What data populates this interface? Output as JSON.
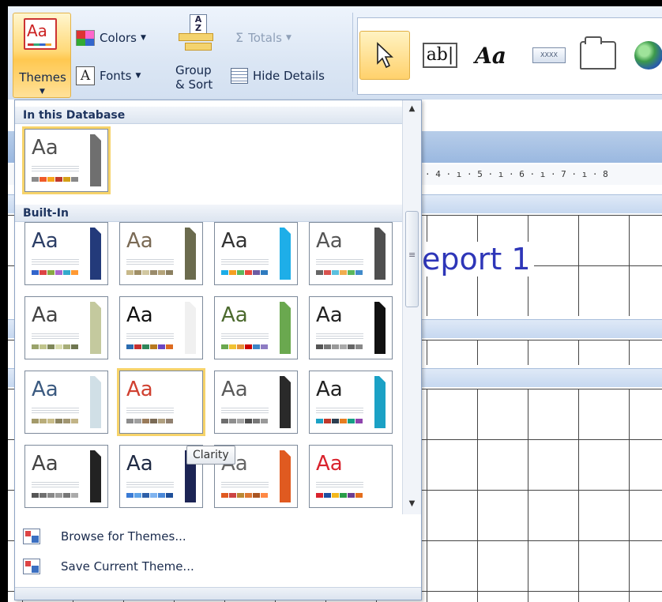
{
  "ribbon": {
    "themes_label": "Themes",
    "colors_label": "Colors",
    "fonts_label": "Fonts",
    "group_sort_label_1": "Group",
    "group_sort_label_2": "& Sort",
    "totals_label": "Totals",
    "hide_details_label": "Hide Details",
    "sort_icon_text": "A Z",
    "controls": {
      "textbox_text": "ab|",
      "label_text": "Aa",
      "button_text": "XXXX"
    }
  },
  "report": {
    "title": "eport 1",
    "ruler": "· 4 · ı · 5 · ı · 6 · ı · 7 · ı · 8"
  },
  "gallery": {
    "section_db": "In this Database",
    "section_builtin": "Built-In",
    "tooltip": "Clarity",
    "browse_label": "Browse for Themes...",
    "save_label": "Save Current Theme...",
    "themes": [
      {
        "aa": "Aa",
        "color": "#505050",
        "strip": "#6f6f6f",
        "swatches": [
          "#8a8a8a",
          "#f05a28",
          "#f7a51c",
          "#c0392b",
          "#d4a017",
          "#888"
        ]
      },
      {
        "aa": "Aa",
        "color": "#2c3e66",
        "strip": "#233a7a",
        "swatches": [
          "#36c",
          "#d44",
          "#8a4",
          "#a6c",
          "#3ac",
          "#f93"
        ]
      },
      {
        "aa": "Aa",
        "color": "#7a6a55",
        "strip": "#6b6b4e",
        "swatches": [
          "#c8b98a",
          "#a08f66",
          "#d1c7a0",
          "#9a8b6b",
          "#b5a47a",
          "#8b7f60"
        ]
      },
      {
        "aa": "Aa",
        "color": "#333333",
        "strip": "#1eaee8",
        "swatches": [
          "#1eaee8",
          "#f59f20",
          "#5cb85c",
          "#e94b3c",
          "#6d5ba3",
          "#2f7bbf"
        ]
      },
      {
        "aa": "Aa",
        "color": "#555555",
        "strip": "#4f4f4f",
        "swatches": [
          "#666",
          "#d9534f",
          "#5bc0de",
          "#f0ad4e",
          "#5cb85c",
          "#428bca"
        ]
      },
      {
        "aa": "Aa",
        "color": "#444444",
        "strip": "#c4c99e",
        "swatches": [
          "#9aa36b",
          "#c0c48c",
          "#7f8759",
          "#d9dcae",
          "#a7ad78",
          "#6f7650"
        ]
      },
      {
        "aa": "Aa",
        "color": "#111111",
        "strip": "#f0f0f0",
        "swatches": [
          "#2b6cb0",
          "#c53030",
          "#2f855a",
          "#b7791f",
          "#6b46c1",
          "#dd6b20"
        ]
      },
      {
        "aa": "Aa",
        "color": "#4c6a2e",
        "strip": "#6aa84f",
        "swatches": [
          "#6aa84f",
          "#f1c232",
          "#e69138",
          "#cc0000",
          "#3d85c6",
          "#8e7cc3"
        ]
      },
      {
        "aa": "Aa",
        "color": "#222222",
        "strip": "#111111",
        "swatches": [
          "#555",
          "#777",
          "#999",
          "#aaa",
          "#666",
          "#888"
        ]
      },
      {
        "aa": "Aa",
        "color": "#3b5a80",
        "strip": "#d0dfe6",
        "swatches": [
          "#a39a6a",
          "#b9ad7a",
          "#c9bd8a",
          "#8c8460",
          "#a19672",
          "#c2b487"
        ]
      },
      {
        "aa": "Aa",
        "color": "#d04030",
        "strip": "#ffffff",
        "swatches": [
          "#8c8c8c",
          "#a0a0a0",
          "#9a7b5a",
          "#7a6a55",
          "#b0a080",
          "#908070"
        ]
      },
      {
        "aa": "Aa",
        "color": "#5a5a5a",
        "strip": "#2a2a2a",
        "swatches": [
          "#6e6e6e",
          "#8e8e8e",
          "#a6a6a6",
          "#4f4f4f",
          "#787878",
          "#9a9a9a"
        ]
      },
      {
        "aa": "Aa",
        "color": "#222222",
        "strip": "#1ba1c5",
        "swatches": [
          "#1ba1c5",
          "#c0392b",
          "#2c3e50",
          "#e67e22",
          "#16a085",
          "#8e44ad"
        ]
      },
      {
        "aa": "Aa",
        "color": "#444444",
        "strip": "#222222",
        "swatches": [
          "#555",
          "#6f6f6f",
          "#888",
          "#9c9c9c",
          "#777",
          "#aaa"
        ]
      },
      {
        "aa": "Aa",
        "color": "#1f2a44",
        "strip": "#1c2454",
        "swatches": [
          "#3a7bd5",
          "#5fa3e8",
          "#2d5fa8",
          "#7fb3ef",
          "#4a88d8",
          "#1f4f99"
        ]
      },
      {
        "aa": "Aa",
        "color": "#666666",
        "strip": "#e05a20",
        "swatches": [
          "#e05a20",
          "#c44",
          "#b83",
          "#d73",
          "#a52",
          "#f84"
        ]
      },
      {
        "aa": "Aa",
        "color": "#d9232d",
        "strip": "#ffffff",
        "swatches": [
          "#d9232d",
          "#1e4fa1",
          "#f4b81c",
          "#2a9d48",
          "#6c3d91",
          "#e46d1c"
        ]
      }
    ]
  }
}
